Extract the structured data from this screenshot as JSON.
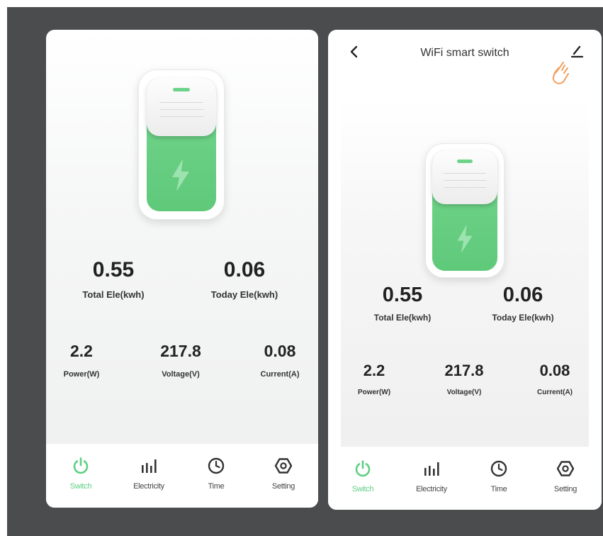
{
  "colors": {
    "accent": "#5fcf84",
    "switch_green": "#6dd38a",
    "background": "#4b4c4e"
  },
  "left_screen": {
    "total_ele": {
      "value": "0.55",
      "label": "Total Ele(kwh)"
    },
    "today_ele": {
      "value": "0.06",
      "label": "Today Ele(kwh)"
    },
    "power": {
      "value": "2.2",
      "label": "Power(W)"
    },
    "voltage": {
      "value": "217.8",
      "label": "Voltage(V)"
    },
    "current": {
      "value": "0.08",
      "label": "Current(A)"
    },
    "tabs": [
      {
        "label": "Switch",
        "icon": "power-icon",
        "active": true
      },
      {
        "label": "Electricity",
        "icon": "bar-chart-icon",
        "active": false
      },
      {
        "label": "Time",
        "icon": "clock-icon",
        "active": false
      },
      {
        "label": "Setting",
        "icon": "gear-icon",
        "active": false
      }
    ]
  },
  "right_screen": {
    "header": {
      "title": "WiFi smart switch",
      "back_icon": "back-icon",
      "edit_icon": "edit-icon"
    },
    "total_ele": {
      "value": "0.55",
      "label": "Total Ele(kwh)"
    },
    "today_ele": {
      "value": "0.06",
      "label": "Today Ele(kwh)"
    },
    "power": {
      "value": "2.2",
      "label": "Power(W)"
    },
    "voltage": {
      "value": "217.8",
      "label": "Voltage(V)"
    },
    "current": {
      "value": "0.08",
      "label": "Current(A)"
    },
    "tabs": [
      {
        "label": "Switch",
        "icon": "power-icon",
        "active": true
      },
      {
        "label": "Electricity",
        "icon": "bar-chart-icon",
        "active": false
      },
      {
        "label": "Time",
        "icon": "clock-icon",
        "active": false
      },
      {
        "label": "Setting",
        "icon": "gear-icon",
        "active": false
      }
    ]
  }
}
